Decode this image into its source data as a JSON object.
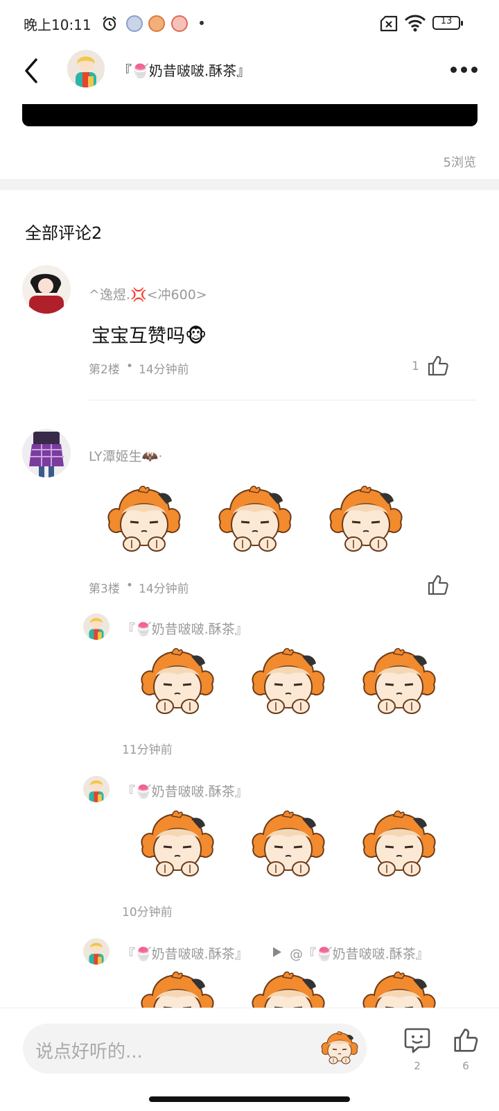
{
  "status_bar": {
    "time": "晚上10:11",
    "battery": "13"
  },
  "header": {
    "title": "『🍧奶昔啵啵.酥茶』"
  },
  "post": {
    "views": "5浏览"
  },
  "comments_section": {
    "title": "全部评论2"
  },
  "comments": [
    {
      "username": "^逸煜.💢<冲600>",
      "text": "宝宝互赞吗🐵",
      "floor": "第2楼",
      "time": "14分钟前",
      "likes": "1"
    },
    {
      "username": "LY潭姬生🦇·",
      "floor": "第3楼",
      "time": "14分钟前",
      "likes": ""
    }
  ],
  "replies": [
    {
      "username": "『🍧奶昔啵啵.酥茶』",
      "time": "11分钟前"
    },
    {
      "username": "『🍧奶昔啵啵.酥茶』",
      "time": "10分钟前"
    },
    {
      "username": "『🍧奶昔啵啵.酥茶』",
      "reply_to": "@『🍧奶昔啵啵.酥茶』"
    }
  ],
  "bottom_bar": {
    "placeholder": "说点好听的...",
    "comment_count": "2",
    "like_count": "6"
  },
  "colors": {
    "sticker_orange": "#f28a2e",
    "sticker_face": "#fbe9d6",
    "meta_gray": "#9a9a9a"
  }
}
